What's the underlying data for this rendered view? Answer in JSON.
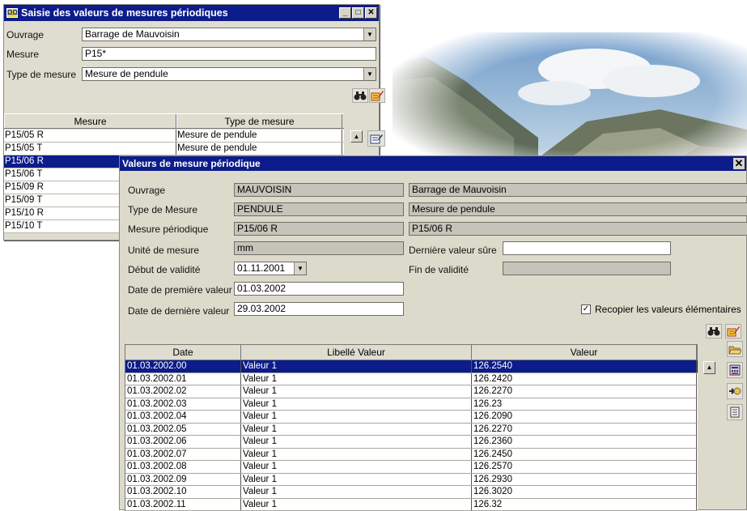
{
  "win1": {
    "title": "Saisie des valeurs de mesures périodiques",
    "ouvrage_label": "Ouvrage",
    "ouvrage_value": "Barrage de Mauvoisin",
    "mesure_label": "Mesure",
    "mesure_value": "P15*",
    "type_label": "Type de mesure",
    "type_value": "Mesure de pendule",
    "col_mesure": "Mesure",
    "col_type": "Type de mesure",
    "rows": [
      {
        "mesure": "P15/05 R",
        "type": "Mesure de pendule"
      },
      {
        "mesure": "P15/05 T",
        "type": "Mesure de pendule"
      },
      {
        "mesure": "P15/06 R",
        "type": ""
      },
      {
        "mesure": "P15/06 T",
        "type": ""
      },
      {
        "mesure": "P15/09 R",
        "type": ""
      },
      {
        "mesure": "P15/09 T",
        "type": ""
      },
      {
        "mesure": "P15/10 R",
        "type": ""
      },
      {
        "mesure": "P15/10 T",
        "type": ""
      }
    ],
    "selected_row": 2
  },
  "win2": {
    "title": "Valeurs de mesure périodique",
    "ouvrage_label": "Ouvrage",
    "ouvrage_code": "MAUVOISIN",
    "ouvrage_name": "Barrage de Mauvoisin",
    "type_label": "Type de Mesure",
    "type_code": "PENDULE",
    "type_name": "Mesure de pendule",
    "mesure_label": "Mesure périodique",
    "mesure_code": "P15/06 R",
    "mesure_name": "P15/06 R",
    "unite_label": "Unité de mesure",
    "unite_value": "mm",
    "derniere_sure_label": "Dernière valeur sûre",
    "derniere_sure_value": "",
    "debut_label": "Début de validité",
    "debut_value": "01.11.2001",
    "fin_label": "Fin de validité",
    "fin_value": "",
    "premiere_label": "Date de première valeur",
    "premiere_value": "01.03.2002",
    "derniere_label": "Date de dernière valeur",
    "derniere_value": "29.03.2002",
    "recopier_label": "Recopier les valeurs élémentaires",
    "recopier_checked": true,
    "col_date": "Date",
    "col_libelle": "Libellé Valeur",
    "col_valeur": "Valeur",
    "rows": [
      {
        "date": "01.03.2002.00",
        "libelle": "Valeur 1",
        "valeur": "126.2540"
      },
      {
        "date": "01.03.2002.01",
        "libelle": "Valeur 1",
        "valeur": "126.2420"
      },
      {
        "date": "01.03.2002.02",
        "libelle": "Valeur 1",
        "valeur": "126.2270"
      },
      {
        "date": "01.03.2002.03",
        "libelle": "Valeur 1",
        "valeur": "126.23"
      },
      {
        "date": "01.03.2002.04",
        "libelle": "Valeur 1",
        "valeur": "126.2090"
      },
      {
        "date": "01.03.2002.05",
        "libelle": "Valeur 1",
        "valeur": "126.2270"
      },
      {
        "date": "01.03.2002.06",
        "libelle": "Valeur 1",
        "valeur": "126.2360"
      },
      {
        "date": "01.03.2002.07",
        "libelle": "Valeur 1",
        "valeur": "126.2450"
      },
      {
        "date": "01.03.2002.08",
        "libelle": "Valeur 1",
        "valeur": "126.2570"
      },
      {
        "date": "01.03.2002.09",
        "libelle": "Valeur 1",
        "valeur": "126.2930"
      },
      {
        "date": "01.03.2002.10",
        "libelle": "Valeur 1",
        "valeur": "126.3020"
      },
      {
        "date": "01.03.2002.11",
        "libelle": "Valeur 1",
        "valeur": "126.32"
      }
    ],
    "selected_row": 0
  },
  "icons": [
    "binoculars-icon",
    "edit-icon",
    "open-folder-icon",
    "calculator-icon",
    "arrow-icon",
    "document-icon"
  ],
  "colors": {
    "titlebar": "#0c1c8a",
    "window_bg": "#dfddcf",
    "selection": "#0c1c8a",
    "readonly_field": "#c6c4ba"
  }
}
